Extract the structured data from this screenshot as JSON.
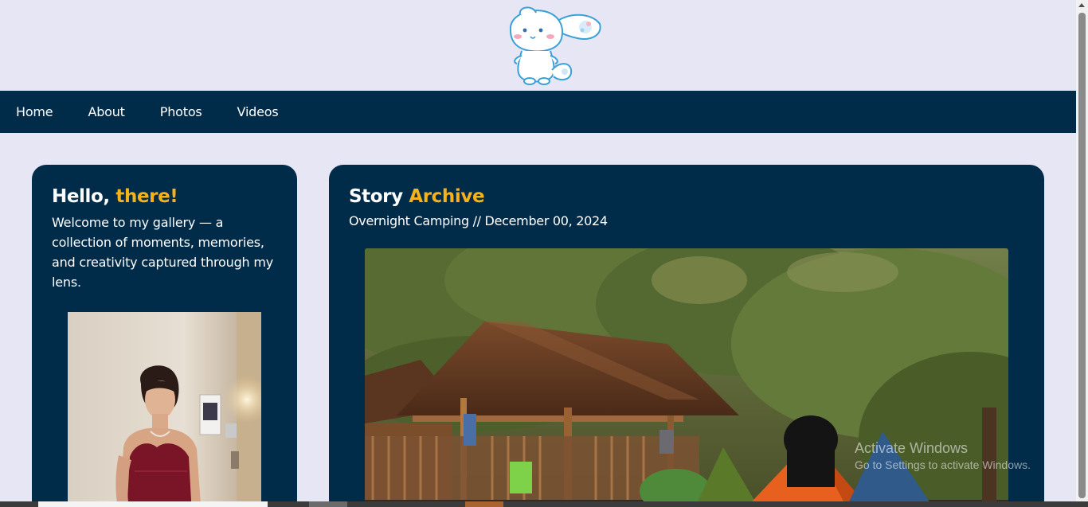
{
  "nav": {
    "items": [
      {
        "label": "Home"
      },
      {
        "label": "About"
      },
      {
        "label": "Photos"
      },
      {
        "label": "Videos"
      }
    ]
  },
  "intro": {
    "greeting": "Hello,",
    "greeting_accent": "there!",
    "text": "Welcome to my gallery — a collection of moments, memories, and creativity captured through my lens."
  },
  "story": {
    "title": "Story",
    "title_accent": "Archive",
    "subtitle": "Overnight Camping // December 00, 2024"
  },
  "watermark": {
    "title": "Activate Windows",
    "subtitle": "Go to Settings to activate Windows."
  },
  "colors": {
    "background": "#e6e6f4",
    "navy": "#002b49",
    "accent": "#f5b21b"
  },
  "icons": {
    "logo": "cinnamoroll-logo-icon"
  }
}
